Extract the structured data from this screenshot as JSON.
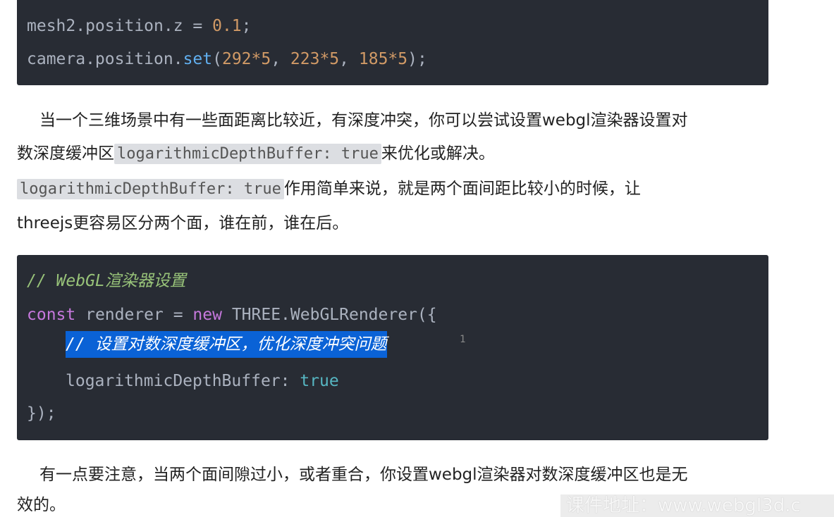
{
  "code_block_1": {
    "line1_obj": "mesh2.position.z",
    "line1_eq": " = ",
    "line1_val": "0.1",
    "line1_end": ";",
    "line2_obj": "camera.position.",
    "line2_fn": "set",
    "line2_open": "(",
    "line2_a": "292*5",
    "line2_sep1": ", ",
    "line2_b": "223*5",
    "line2_sep2": ", ",
    "line2_c": "185*5",
    "line2_end": ");"
  },
  "paragraph_1": {
    "line1": "当一个三维场景中有一些面距离比较近，有深度冲突，你可以尝试设置webgl渲染器设置对",
    "line2_pre": "数深度缓冲区",
    "line2_code": "logarithmicDepthBuffer: true",
    "line2_post": "来优化或解决。",
    "line3_code": "logarithmicDepthBuffer: true",
    "line3_post": "作用简单来说，就是两个面间距比较小的时候，让",
    "line4": "threejs更容易区分两个面，谁在前，谁在后。"
  },
  "code_block_2": {
    "comment1": "// WebGL渲染器设置",
    "kw_const": "const",
    "var_name": " renderer = ",
    "kw_new": "new",
    "ctor": " THREE.WebGLRenderer({",
    "comment2": "// 设置对数深度缓冲区，优化深度冲突问题",
    "line_number": "1",
    "prop": "logarithmicDepthBuffer: ",
    "prop_val": "true",
    "close": "});"
  },
  "paragraph_2": {
    "line1": "有一点要注意，当两个面间隙过小，或者重合，你设置webgl渲染器对数深度缓冲区也是无",
    "line2": "效的。"
  },
  "watermark": "课件地址：www.webgl3d.c"
}
